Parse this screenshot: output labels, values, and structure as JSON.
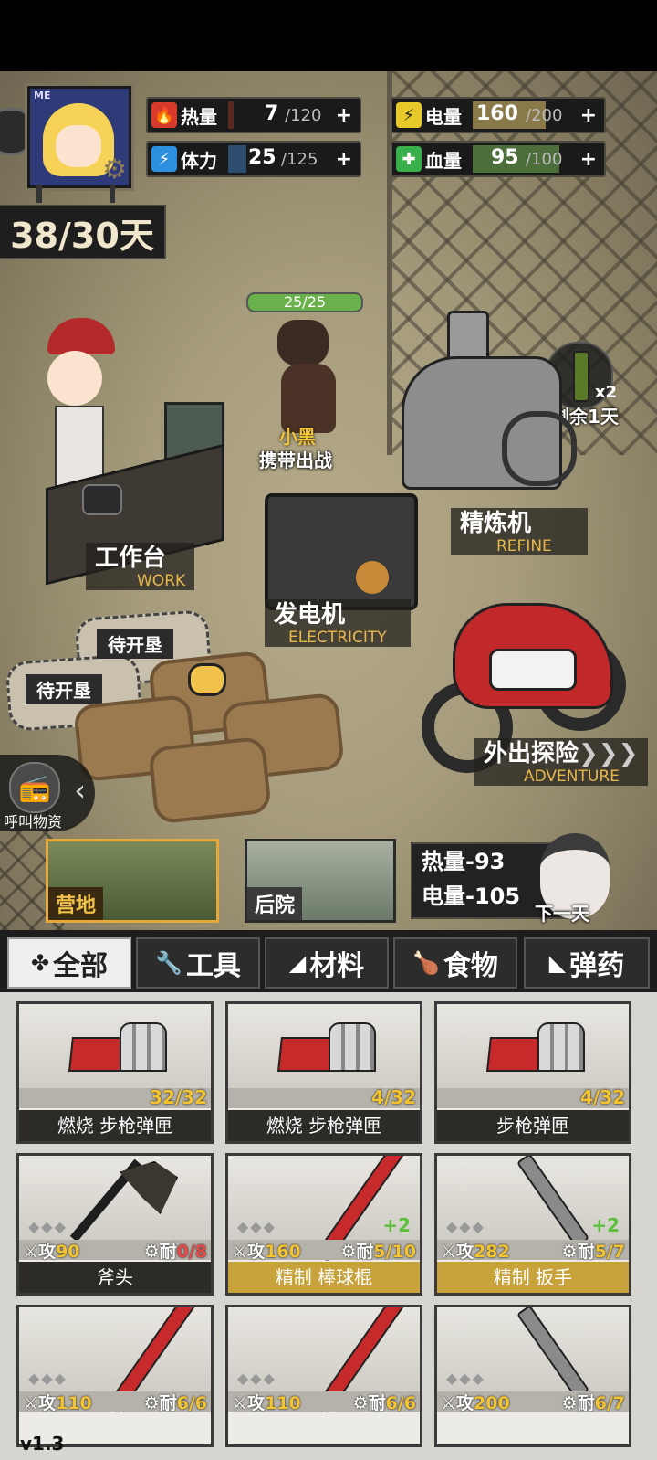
{
  "hud": {
    "avatar_tag": "ME",
    "stats": {
      "heat": {
        "label": "热量",
        "value": "7",
        "max": "/120",
        "plus": "+",
        "level": 0.06
      },
      "power": {
        "label": "电量",
        "value": "160",
        "max": "/200",
        "plus": "+",
        "level": 0.8
      },
      "stamina": {
        "label": "体力",
        "value": "25",
        "max": "/125",
        "plus": "+",
        "level": 0.2
      },
      "blood": {
        "label": "血量",
        "value": "95",
        "max": "/100",
        "plus": "+",
        "level": 0.95
      }
    },
    "days": "38/30天"
  },
  "scene": {
    "dog_hp": "25/25",
    "dog_name": "小黑",
    "dog_action": "携带出战",
    "bottle_count": "x2",
    "bottle_remaining": "剩余1天",
    "workbench": {
      "cn": "工作台",
      "en": "WORK"
    },
    "refine": {
      "cn": "精炼机",
      "en": "REFINE"
    },
    "generator": {
      "cn": "发电机",
      "en": "ELECTRICITY"
    },
    "adventure": {
      "cn": "外出探险",
      "en": "ADVENTURE"
    },
    "plots": [
      "待开垦",
      "待开垦"
    ],
    "call_supplies": "呼叫物资"
  },
  "locations": {
    "camp": "营地",
    "backyard": "后院",
    "heat_cost": "热量-93",
    "power_cost": "电量-105",
    "next_day": "下一天"
  },
  "tabs": [
    {
      "icon": "✤",
      "label": "全部"
    },
    {
      "icon": "🔧",
      "label": "工具"
    },
    {
      "icon": "◢",
      "label": "材料"
    },
    {
      "icon": "🍗",
      "label": "食物"
    },
    {
      "icon": "◣",
      "label": "弹药"
    }
  ],
  "inventory": [
    {
      "name": "燃烧 步枪弹匣",
      "count": "32/32"
    },
    {
      "name": "燃烧 步枪弹匣",
      "count": "4/32"
    },
    {
      "name": "步枪弹匣",
      "count": "4/32"
    },
    {
      "name": "斧头",
      "atk_label": "攻",
      "atk": "90",
      "dur_label": "耐",
      "dur": "0/8"
    },
    {
      "name": "精制 棒球棍",
      "atk_label": "攻",
      "atk": "160",
      "dur_label": "耐",
      "dur": "5/10",
      "bonus": "+2"
    },
    {
      "name": "精制 扳手",
      "atk_label": "攻",
      "atk": "282",
      "dur_label": "耐",
      "dur": "5/7",
      "bonus": "+2"
    },
    {
      "atk_label": "攻",
      "atk": "110",
      "dur_label": "耐",
      "dur": "6/6"
    },
    {
      "atk_label": "攻",
      "atk": "110",
      "dur_label": "耐",
      "dur": "6/6"
    },
    {
      "atk_label": "攻",
      "atk": "200",
      "dur_label": "耐",
      "dur": "6/7"
    }
  ],
  "version": "v1.3",
  "colors": {
    "accent": "#f4c430",
    "heat_bar": "#5a2a22",
    "power_bar": "#8a7a4a",
    "stamina_bar": "#2d4d6e",
    "blood_bar": "#4c6e3a"
  }
}
